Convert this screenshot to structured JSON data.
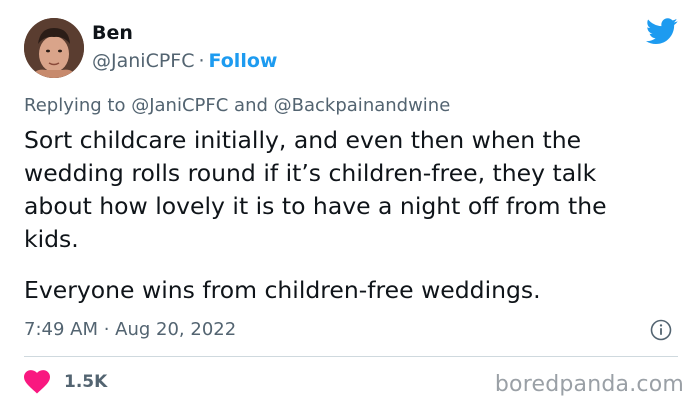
{
  "author": {
    "name": "Ben",
    "handle": "@JaniCPFC",
    "separator": "·",
    "follow_label": "Follow"
  },
  "reply": {
    "prefix": "Replying to",
    "mention_1": "@JaniCPFC",
    "conjunction": "and",
    "mention_2": "@Backpainandwine"
  },
  "tweet": {
    "paragraph_1": "Sort childcare initially, and even then when the\nwedding rolls round if it’s children-free, they talk\nabout how lovely it is to have a night off from the\nkids.",
    "paragraph_2": "Everyone wins from children-free weddings."
  },
  "meta": {
    "timestamp": "7:49 AM · Aug 20, 2022"
  },
  "engagement": {
    "likes": "1.5K"
  },
  "watermark": "boredpanda.com",
  "colors": {
    "accent": "#1d9bf0",
    "heart": "#f91880",
    "muted": "#536471"
  },
  "icons": {
    "brand": "twitter-bird-icon",
    "info": "info-icon",
    "like": "heart-icon"
  }
}
